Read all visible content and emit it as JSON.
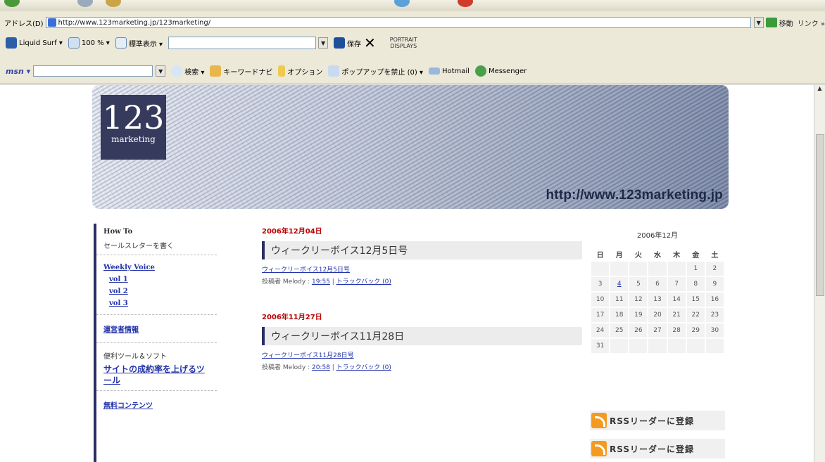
{
  "browser": {
    "address_label": "アドレス(D)",
    "url": "http://www.123marketing.jp/123marketing/",
    "go_label": "移動",
    "links_label": "リンク »",
    "toolbar2": {
      "liquid_surf": "Liquid Surf ▾",
      "zoom": "100 % ▾",
      "view_mode": "標準表示 ▾",
      "save": "保存",
      "portrait_line1": "PORTRAIT",
      "portrait_line2": "DISPLAYS"
    },
    "toolbar3": {
      "msn": "msn ▾",
      "search": "検索 ▾",
      "keyword_navi": "キーワードナビ",
      "options": "オプション",
      "popup_block": "ポップアップを禁止 (0) ▾",
      "hotmail": "Hotmail",
      "messenger": "Messenger"
    }
  },
  "banner": {
    "logo_number": "123",
    "logo_word": "marketing",
    "url_text": "http://www.123marketing.jp"
  },
  "sidebar": {
    "howto_heading": "How To",
    "howto_item": "セールスレターを書く",
    "weekly_heading": "Weekly Voice",
    "weekly_items": [
      "vol 1",
      "vol 2",
      "vol 3"
    ],
    "operator": "運営者情報",
    "tools_heading": "便利ツール＆ソフト",
    "tools_link": "サイトの成約率を上げるツール",
    "free_content": "無料コンテンツ"
  },
  "posts": [
    {
      "date": "2006年12月04日",
      "title": "ウィークリーボイス12月5日号",
      "link": "ウィークリーボイス12月5日号",
      "meta_prefix": "投稿者 Melody : ",
      "time": "19:55",
      "trackback": "トラックバック (0)"
    },
    {
      "date": "2006年11月27日",
      "title": "ウィークリーボイス11月28日",
      "link": "ウィークリーボイス11月28日号",
      "meta_prefix": "投稿者 Melody : ",
      "time": "20:58",
      "trackback": "トラックバック (0)"
    }
  ],
  "calendar": {
    "caption": "2006年12月",
    "weekdays": [
      "日",
      "月",
      "火",
      "水",
      "木",
      "金",
      "土"
    ],
    "rows": [
      [
        "",
        "",
        "",
        "",
        "",
        "1",
        "2"
      ],
      [
        "3",
        "4",
        "5",
        "6",
        "7",
        "8",
        "9"
      ],
      [
        "10",
        "11",
        "12",
        "13",
        "14",
        "15",
        "16"
      ],
      [
        "17",
        "18",
        "19",
        "20",
        "21",
        "22",
        "23"
      ],
      [
        "24",
        "25",
        "26",
        "27",
        "28",
        "29",
        "30"
      ],
      [
        "31",
        "",
        "",
        "",
        "",
        "",
        ""
      ]
    ],
    "linked_days": [
      "4"
    ]
  },
  "rss": [
    "RSSリーダーに登録",
    "RSSリーダーに登録"
  ]
}
